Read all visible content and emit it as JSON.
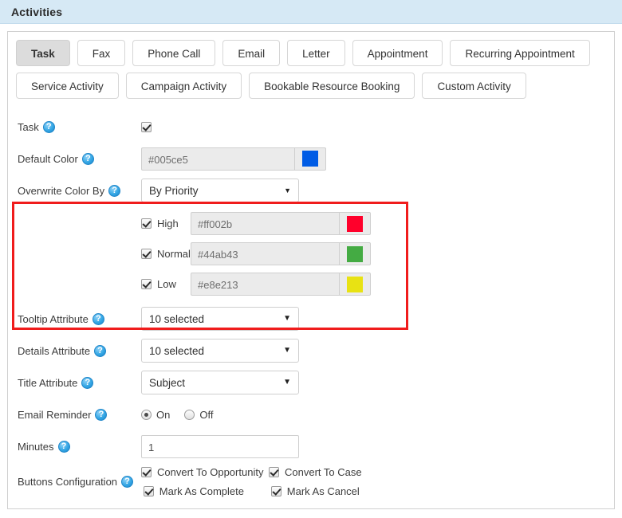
{
  "header": {
    "title": "Activities"
  },
  "tabs": {
    "row1": [
      {
        "label": "Task",
        "active": true
      },
      {
        "label": "Fax",
        "active": false
      },
      {
        "label": "Phone Call",
        "active": false
      },
      {
        "label": "Email",
        "active": false
      },
      {
        "label": "Letter",
        "active": false
      },
      {
        "label": "Appointment",
        "active": false
      },
      {
        "label": "Recurring Appointment",
        "active": false
      }
    ],
    "row2": [
      {
        "label": "Service Activity",
        "active": false
      },
      {
        "label": "Campaign Activity",
        "active": false
      },
      {
        "label": "Bookable Resource Booking",
        "active": false
      },
      {
        "label": "Custom Activity",
        "active": false
      }
    ]
  },
  "form": {
    "task": {
      "label": "Task",
      "checked": true
    },
    "default_color": {
      "label": "Default Color",
      "value": "#005ce5",
      "swatch": "#005ce5"
    },
    "overwrite_color_by": {
      "label": "Overwrite Color By",
      "value": "By Priority",
      "arrow": "▼"
    },
    "priorities": [
      {
        "label": "High",
        "checked": true,
        "value": "#ff002b",
        "swatch": "#ff002b"
      },
      {
        "label": "Normal",
        "checked": true,
        "value": "#44ab43",
        "swatch": "#44ab43"
      },
      {
        "label": "Low",
        "checked": true,
        "value": "#e8e213",
        "swatch": "#e8e213"
      }
    ],
    "tooltip_attribute": {
      "label": "Tooltip Attribute",
      "value": "10 selected",
      "arrow": "▼"
    },
    "details_attribute": {
      "label": "Details Attribute",
      "value": "10 selected",
      "arrow": "▼"
    },
    "title_attribute": {
      "label": "Title Attribute",
      "value": "Subject",
      "arrow": "▼"
    },
    "email_reminder": {
      "label": "Email Reminder",
      "on_label": "On",
      "off_label": "Off",
      "selected": "On"
    },
    "minutes": {
      "label": "Minutes",
      "value": "1"
    },
    "buttons_configuration": {
      "label": "Buttons Configuration",
      "items": [
        {
          "label": "Convert To Opportunity",
          "checked": true
        },
        {
          "label": "Convert To Case",
          "checked": true
        },
        {
          "label": "Mark As Complete",
          "checked": true
        },
        {
          "label": "Mark As Cancel",
          "checked": true
        }
      ]
    }
  },
  "icons": {
    "help": "?"
  },
  "colors": {
    "header_bg": "#d6e9f5",
    "highlight_border": "#f01c1c",
    "active_tab_bg": "#dcdcdc",
    "help_icon": "#35a7e5"
  }
}
